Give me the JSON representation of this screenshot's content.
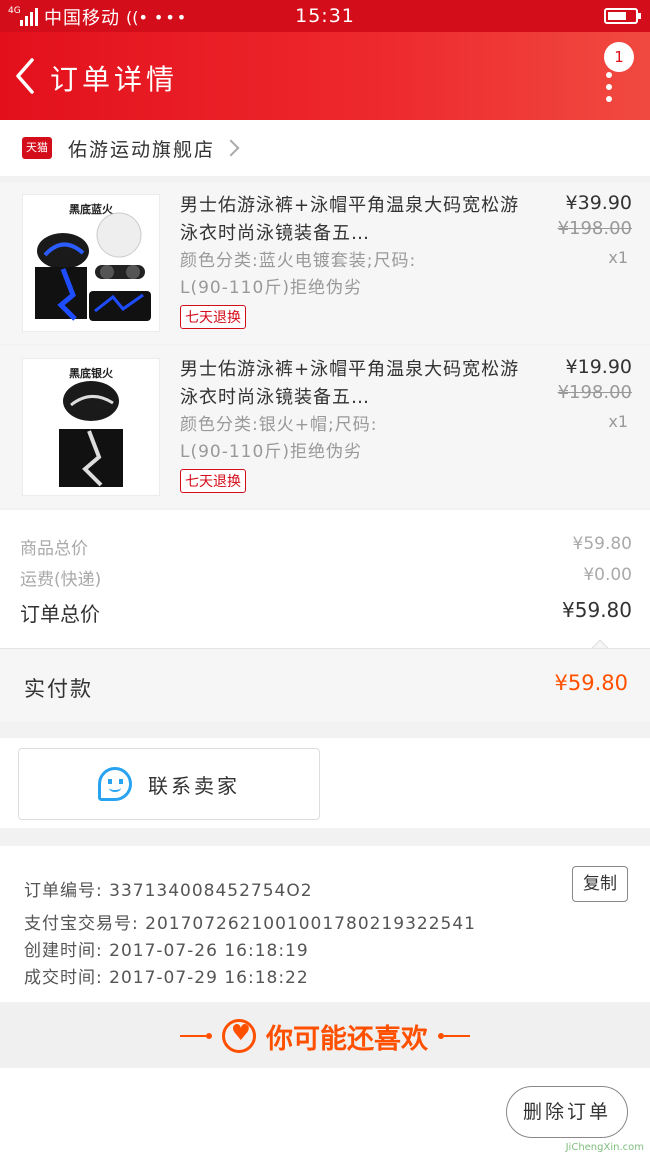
{
  "status": {
    "carrier": "中国移动",
    "network": "4G",
    "time": "15:31",
    "battery_level": 0.7
  },
  "header": {
    "title": "订单详情",
    "message_count": "1"
  },
  "shop": {
    "badge": "天猫",
    "name": "佑游运动旗舰店"
  },
  "items": [
    {
      "title": "男士佑游泳裤+泳帽平角温泉大码宽松游泳衣时尚泳镜装备五…",
      "spec_line1": "颜色分类:蓝火电镀套装;尺码:",
      "spec_line2": "L(90-110斤)拒绝伪劣",
      "tag": "七天退换",
      "price": "¥39.90",
      "original_price": "¥198.00",
      "qty": "x1",
      "image_caption": "黑底蓝火"
    },
    {
      "title": "男士佑游泳裤+泳帽平角温泉大码宽松游泳衣时尚泳镜装备五…",
      "spec_line1": "颜色分类:银火+帽;尺码:",
      "spec_line2": "L(90-110斤)拒绝伪劣",
      "tag": "七天退换",
      "price": "¥19.90",
      "original_price": "¥198.00",
      "qty": "x1",
      "image_caption": "黑底银火"
    }
  ],
  "summary": {
    "goods_label": "商品总价",
    "goods_value": "¥59.80",
    "shipping_label": "运费(快递)",
    "shipping_value": "¥0.00",
    "total_label": "订单总价",
    "total_value": "¥59.80"
  },
  "paid": {
    "label": "实付款",
    "value": "¥59.80"
  },
  "contact": {
    "label": "联系卖家"
  },
  "order_info": {
    "order_no": "订单编号: 337134008452754O2",
    "alipay_no": "支付宝交易号: 2017072621001001780219322541",
    "created": "创建时间: 2017-07-26 16:18:19",
    "completed": "成交时间: 2017-07-29 16:18:22",
    "copy_label": "复制"
  },
  "recommend": {
    "title": "你可能还喜欢"
  },
  "actions": {
    "delete_label": "删除订单"
  },
  "watermark": "JiChengXin.com",
  "colors": {
    "brand_red": "#d40d1a",
    "price_orange": "#ff5000",
    "wangwang_blue": "#27a3f1"
  }
}
